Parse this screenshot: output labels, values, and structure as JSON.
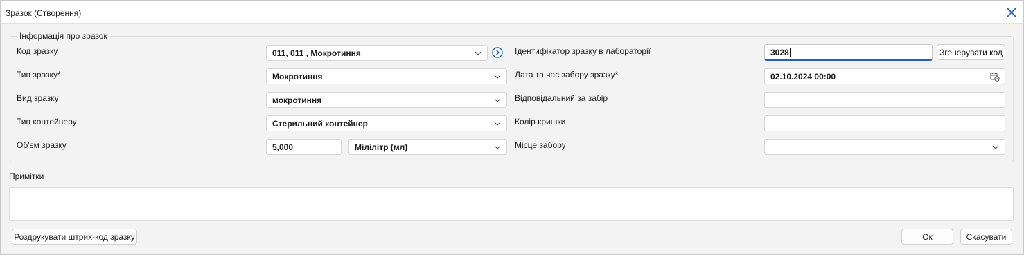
{
  "window": {
    "title": "Зразок (Створення)"
  },
  "group": {
    "legend": "Інформація про зразок"
  },
  "left": {
    "code_label": "Код зразку",
    "code_value": "011, 011 , Мокротиння",
    "type_label": "Тип зразку*",
    "type_value": "Мокротиння",
    "kind_label": "Вид зразку",
    "kind_value": "мокротиння",
    "container_label": "Тип контейнеру",
    "container_value": "Стерильний контейнер",
    "volume_label": "Об'єм зразку",
    "volume_value": "5,000",
    "unit_value": "Мілілітр (мл)"
  },
  "right": {
    "lab_id_label": "Ідентифікатор зразку в лабораторії",
    "lab_id_value": "3028",
    "generate_label": "Згенерувати код",
    "datetime_label": "Дата та час забору зразку*",
    "datetime_value": "02.10.2024 00:00",
    "responsible_label": "Відповідальний за забір",
    "responsible_value": "",
    "cap_color_label": "Колір кришки",
    "cap_color_value": "",
    "place_label": "Місце забору",
    "place_value": ""
  },
  "notes": {
    "label": "Примітки",
    "value": ""
  },
  "footer": {
    "print_label": "Роздрукувати штрих-код зразку",
    "ok_label": "Ок",
    "cancel_label": "Скасувати"
  },
  "colors": {
    "accent": "#1f5fb8",
    "close_icon": "#1f5fb8"
  },
  "icons": [
    "close-icon",
    "chevron-down-icon",
    "navigate-icon",
    "calendar-clock-icon"
  ]
}
